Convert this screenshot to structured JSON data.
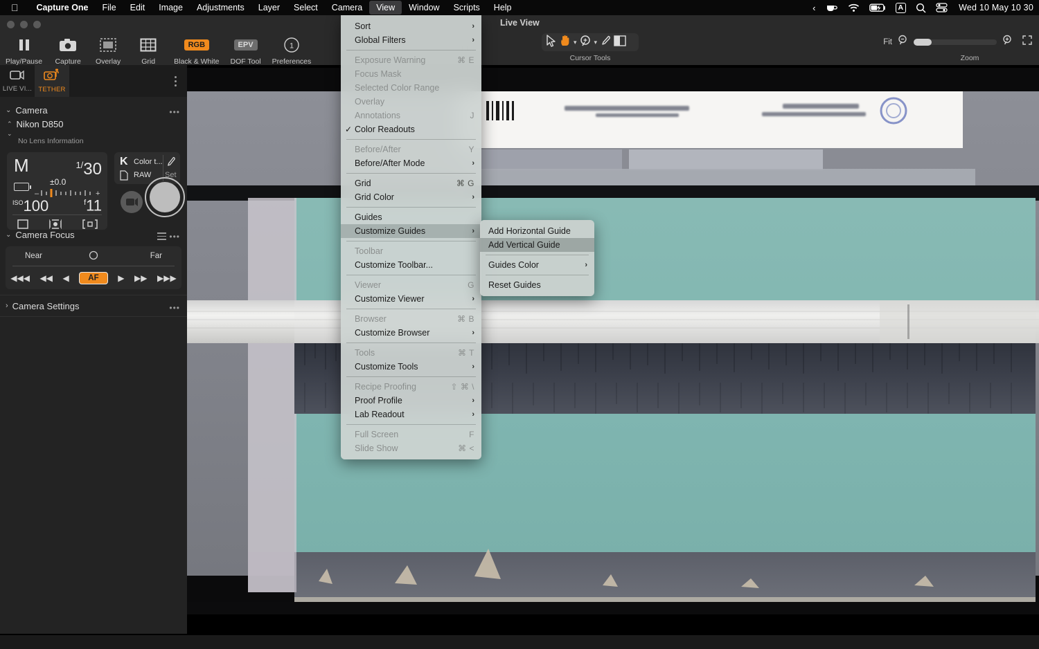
{
  "menubar": {
    "apple_icon": "apple-icon",
    "app_name": "Capture One",
    "items": [
      "File",
      "Edit",
      "Image",
      "Adjustments",
      "Layer",
      "Select",
      "Camera",
      "View",
      "Window",
      "Scripts",
      "Help"
    ],
    "active_item": "View",
    "status": {
      "chevron": "‹",
      "coffee_icon": "coffee-cup-icon",
      "wifi_icon": "wifi-icon",
      "battery_icon": "battery-charging-icon",
      "input_source": "A",
      "search_icon": "search-icon",
      "control_center_icon": "control-center-icon",
      "clock": "Wed 10 May  10 30"
    }
  },
  "toolbar": {
    "items": [
      {
        "label": "Play/Pause",
        "icon": "pause-icon"
      },
      {
        "label": "Capture",
        "icon": "camera-icon"
      },
      {
        "label": "Overlay",
        "icon": "overlay-icon"
      },
      {
        "label": "Grid",
        "icon": "grid-icon"
      },
      {
        "label": "Black & White",
        "icon": "rgb-chip",
        "chip": "RGB"
      },
      {
        "label": "DOF Tool",
        "icon": "epv-chip",
        "chip": "EPV"
      },
      {
        "label": "Preferences",
        "icon": "numbered-circle-icon",
        "chip": "1"
      }
    ]
  },
  "viewer_header": {
    "title": "Live View",
    "cursor_tools_label": "Cursor Tools",
    "cursor_tools": [
      "pointer-icon",
      "pan-hand-icon",
      "zoom-loupe-icon",
      "color-picker-icon",
      "before-after-icon"
    ],
    "zoom_label": "Zoom",
    "zoom_fit": "Fit",
    "zoom_out_icon": "zoom-out-icon",
    "zoom_in_icon": "zoom-in-icon",
    "fullscreen_icon": "fullscreen-icon"
  },
  "left_panel": {
    "tabs": [
      {
        "label": "LIVE VI...",
        "icon": "live-view-icon",
        "selected": false
      },
      {
        "label": "TETHER",
        "icon": "tether-camera-icon",
        "selected": true
      }
    ],
    "camera_section": {
      "title": "Camera",
      "body_name": "Nikon D850",
      "lens_info": "No Lens Information",
      "exposure": {
        "mode": "M",
        "shutter_num": "1/",
        "shutter_den": "30",
        "ev_value": "±0.0",
        "ev_scale": "-|ı|ı|ı|ı|ı|ı|+",
        "iso_label": "ISO",
        "iso_value": "100",
        "aperture_prefix": "f",
        "aperture_value": "11",
        "meter_icons": [
          "metering-matrix-icon",
          "metering-center-icon",
          "focus-area-icon"
        ]
      },
      "right_box": {
        "wb_letter": "K",
        "wb_label": "Color t...",
        "file_format": "RAW",
        "pencil_icon": "pencil-icon",
        "set_label": "Set"
      },
      "shutter_button": "shutter-release-button",
      "video_button": "video-record-button"
    },
    "focus_section": {
      "title": "Camera Focus",
      "near_label": "Near",
      "far_label": "Far",
      "af_label": "AF",
      "steps": [
        "◀◀◀",
        "◀◀",
        "◀",
        "AF",
        "▶",
        "▶▶",
        "▶▶▶"
      ]
    },
    "settings_section": {
      "title": "Camera Settings"
    }
  },
  "view_menu": {
    "items": [
      {
        "label": "Sort",
        "submenu": true,
        "disabled": false
      },
      {
        "label": "Global Filters",
        "submenu": true,
        "disabled": false
      },
      {
        "separator": true
      },
      {
        "label": "Exposure Warning",
        "key": "⌘ E",
        "disabled": true
      },
      {
        "label": "Focus Mask",
        "key": "",
        "disabled": true
      },
      {
        "label": "Selected Color Range",
        "key": "",
        "disabled": true
      },
      {
        "label": "Overlay",
        "key": "",
        "disabled": true
      },
      {
        "label": "Annotations",
        "key": "J",
        "disabled": true
      },
      {
        "label": "Color Readouts",
        "key": "",
        "disabled": false,
        "checked": true
      },
      {
        "separator": true
      },
      {
        "label": "Before/After",
        "key": "Y",
        "disabled": true
      },
      {
        "label": "Before/After Mode",
        "submenu": true,
        "disabled": false
      },
      {
        "separator": true
      },
      {
        "label": "Grid",
        "key": "⌘ G",
        "disabled": false
      },
      {
        "label": "Grid Color",
        "submenu": true,
        "disabled": false
      },
      {
        "separator": true
      },
      {
        "label": "Guides",
        "key": "",
        "disabled": false
      },
      {
        "label": "Customize Guides",
        "submenu": true,
        "disabled": false,
        "highlighted": true
      },
      {
        "separator": true
      },
      {
        "label": "Toolbar",
        "key": "",
        "disabled": true
      },
      {
        "label": "Customize Toolbar...",
        "key": "",
        "disabled": false
      },
      {
        "separator": true
      },
      {
        "label": "Viewer",
        "key": "G",
        "disabled": true
      },
      {
        "label": "Customize Viewer",
        "submenu": true,
        "disabled": false
      },
      {
        "separator": true
      },
      {
        "label": "Browser",
        "key": "⌘ B",
        "disabled": true
      },
      {
        "label": "Customize Browser",
        "submenu": true,
        "disabled": false
      },
      {
        "separator": true
      },
      {
        "label": "Tools",
        "key": "⌘ T",
        "disabled": true
      },
      {
        "label": "Customize Tools",
        "submenu": true,
        "disabled": false
      },
      {
        "separator": true
      },
      {
        "label": "Recipe Proofing",
        "key": "⇧ ⌘ \\",
        "disabled": true
      },
      {
        "label": "Proof Profile",
        "submenu": true,
        "disabled": false
      },
      {
        "label": "Lab Readout",
        "submenu": true,
        "disabled": false
      },
      {
        "separator": true
      },
      {
        "label": "Full Screen",
        "key": "F",
        "disabled": true
      },
      {
        "label": "Slide Show",
        "key": "⌘ <",
        "disabled": true
      }
    ]
  },
  "guides_submenu": {
    "items": [
      {
        "label": "Add Horizontal Guide"
      },
      {
        "label": "Add Vertical Guide",
        "highlighted": true
      },
      {
        "separator": true
      },
      {
        "label": "Guides Color",
        "submenu": true
      },
      {
        "separator": true
      },
      {
        "label": "Reset Guides"
      }
    ]
  },
  "colors": {
    "accent": "#f08a1d",
    "menu_bg": "#ced4d2",
    "panel_bg": "#232323",
    "image_teal": "#7fb5b0"
  }
}
